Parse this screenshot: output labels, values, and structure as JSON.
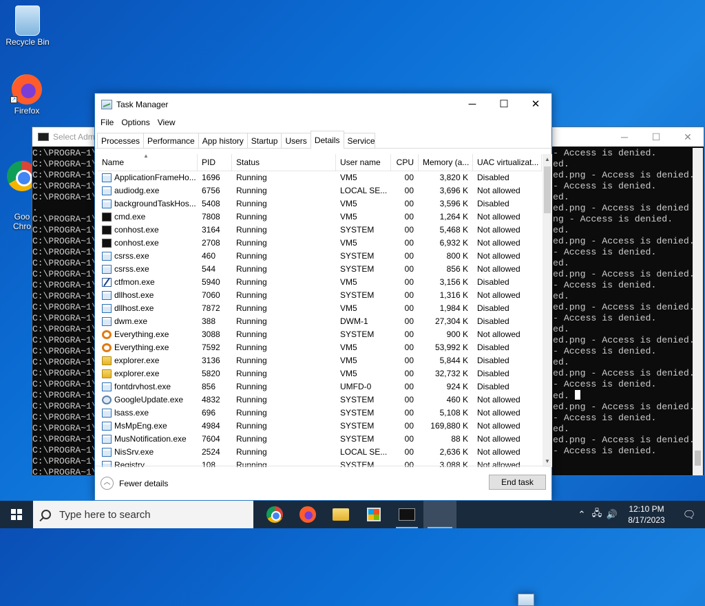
{
  "desktop": {
    "icons": [
      {
        "label": "Recycle Bin"
      },
      {
        "label": "Firefox"
      },
      {
        "label": "Goo\nChro"
      }
    ]
  },
  "console": {
    "title": "Select Admi",
    "left_lines": [
      "C:\\PROGRA~1\\",
      "C:\\PROGRA~1\\",
      "C:\\PROGRA~1\\",
      "C:\\PROGRA~1\\",
      "C:\\PROGRA~1\\",
      ".",
      "C:\\PROGRA~1\\",
      "C:\\PROGRA~1\\",
      "C:\\PROGRA~1\\",
      "C:\\PROGRA~1\\",
      "C:\\PROGRA~1\\",
      "C:\\PROGRA~1\\",
      "C:\\PROGRA~1\\",
      "C:\\PROGRA~1\\",
      "C:\\PROGRA~1\\",
      "C:\\PROGRA~1\\",
      "C:\\PROGRA~1\\",
      "C:\\PROGRA~1\\",
      "C:\\PROGRA~1\\",
      "C:\\PROGRA~1\\",
      "C:\\PROGRA~1\\",
      "C:\\PROGRA~1\\",
      "C:\\PROGRA~1\\",
      "C:\\PROGRA~1\\",
      "C:\\PROGRA~1\\",
      "C:\\PROGRA~1\\",
      "C:\\PROGRA~1\\",
      "C:\\PROGRA~1\\",
      "C:\\PROGRA~1\\",
      "C:\\PROGRA~1\\"
    ],
    "right_lines": [
      "- Access is denied.",
      "ed.",
      "ed.png - Access is denied.",
      "- Access is denied.",
      "ed.",
      "ed.png - Access is denied",
      "",
      "ng - Access is denied.",
      "ed.",
      "ed.png - Access is denied.",
      "- Access is denied.",
      "ed.",
      "ed.png - Access is denied.",
      "- Access is denied.",
      "ed.",
      "ed.png - Access is denied.",
      "- Access is denied.",
      "ed.",
      "ed.png - Access is denied.",
      "- Access is denied.",
      "ed.",
      "ed.png - Access is denied.",
      "- Access is denied.",
      "ed. ",
      "ed.png - Access is denied.",
      "- Access is denied.",
      "ed.",
      "ed.png - Access is denied.",
      "- Access is denied.",
      ""
    ]
  },
  "task_manager": {
    "title": "Task Manager",
    "menu": [
      "File",
      "Options",
      "View"
    ],
    "tabs": [
      "Processes",
      "Performance",
      "App history",
      "Startup",
      "Users",
      "Details",
      "Services"
    ],
    "active_tab": "Details",
    "columns": [
      "Name",
      "PID",
      "Status",
      "User name",
      "CPU",
      "Memory (a...",
      "UAC virtualizat..."
    ],
    "rows": [
      {
        "icon": "app",
        "name": "ApplicationFrameHo...",
        "pid": "1696",
        "status": "Running",
        "user": "VM5",
        "cpu": "00",
        "mem": "3,820 K",
        "uac": "Disabled"
      },
      {
        "icon": "app",
        "name": "audiodg.exe",
        "pid": "6756",
        "status": "Running",
        "user": "LOCAL SE...",
        "cpu": "00",
        "mem": "3,696 K",
        "uac": "Not allowed"
      },
      {
        "icon": "app",
        "name": "backgroundTaskHos...",
        "pid": "5408",
        "status": "Running",
        "user": "VM5",
        "cpu": "00",
        "mem": "3,596 K",
        "uac": "Disabled"
      },
      {
        "icon": "cmd",
        "name": "cmd.exe",
        "pid": "7808",
        "status": "Running",
        "user": "VM5",
        "cpu": "00",
        "mem": "1,264 K",
        "uac": "Not allowed"
      },
      {
        "icon": "cmd",
        "name": "conhost.exe",
        "pid": "3164",
        "status": "Running",
        "user": "SYSTEM",
        "cpu": "00",
        "mem": "5,468 K",
        "uac": "Not allowed"
      },
      {
        "icon": "cmd",
        "name": "conhost.exe",
        "pid": "2708",
        "status": "Running",
        "user": "VM5",
        "cpu": "00",
        "mem": "6,932 K",
        "uac": "Not allowed"
      },
      {
        "icon": "app",
        "name": "csrss.exe",
        "pid": "460",
        "status": "Running",
        "user": "SYSTEM",
        "cpu": "00",
        "mem": "800 K",
        "uac": "Not allowed"
      },
      {
        "icon": "app",
        "name": "csrss.exe",
        "pid": "544",
        "status": "Running",
        "user": "SYSTEM",
        "cpu": "00",
        "mem": "856 K",
        "uac": "Not allowed"
      },
      {
        "icon": "ctf",
        "name": "ctfmon.exe",
        "pid": "5940",
        "status": "Running",
        "user": "VM5",
        "cpu": "00",
        "mem": "3,156 K",
        "uac": "Disabled"
      },
      {
        "icon": "app",
        "name": "dllhost.exe",
        "pid": "7060",
        "status": "Running",
        "user": "SYSTEM",
        "cpu": "00",
        "mem": "1,316 K",
        "uac": "Not allowed"
      },
      {
        "icon": "app",
        "name": "dllhost.exe",
        "pid": "7872",
        "status": "Running",
        "user": "VM5",
        "cpu": "00",
        "mem": "1,984 K",
        "uac": "Disabled"
      },
      {
        "icon": "app",
        "name": "dwm.exe",
        "pid": "388",
        "status": "Running",
        "user": "DWM-1",
        "cpu": "00",
        "mem": "27,304 K",
        "uac": "Disabled"
      },
      {
        "icon": "search",
        "name": "Everything.exe",
        "pid": "3088",
        "status": "Running",
        "user": "SYSTEM",
        "cpu": "00",
        "mem": "900 K",
        "uac": "Not allowed"
      },
      {
        "icon": "search",
        "name": "Everything.exe",
        "pid": "7592",
        "status": "Running",
        "user": "VM5",
        "cpu": "00",
        "mem": "53,992 K",
        "uac": "Disabled"
      },
      {
        "icon": "folder",
        "name": "explorer.exe",
        "pid": "3136",
        "status": "Running",
        "user": "VM5",
        "cpu": "00",
        "mem": "5,844 K",
        "uac": "Disabled"
      },
      {
        "icon": "folder",
        "name": "explorer.exe",
        "pid": "5820",
        "status": "Running",
        "user": "VM5",
        "cpu": "00",
        "mem": "32,732 K",
        "uac": "Disabled"
      },
      {
        "icon": "app",
        "name": "fontdrvhost.exe",
        "pid": "856",
        "status": "Running",
        "user": "UMFD-0",
        "cpu": "00",
        "mem": "924 K",
        "uac": "Disabled"
      },
      {
        "icon": "gear",
        "name": "GoogleUpdate.exe",
        "pid": "4832",
        "status": "Running",
        "user": "SYSTEM",
        "cpu": "00",
        "mem": "460 K",
        "uac": "Not allowed"
      },
      {
        "icon": "app",
        "name": "lsass.exe",
        "pid": "696",
        "status": "Running",
        "user": "SYSTEM",
        "cpu": "00",
        "mem": "5,108 K",
        "uac": "Not allowed"
      },
      {
        "icon": "app",
        "name": "MsMpEng.exe",
        "pid": "4984",
        "status": "Running",
        "user": "SYSTEM",
        "cpu": "00",
        "mem": "169,880 K",
        "uac": "Not allowed"
      },
      {
        "icon": "app",
        "name": "MusNotification.exe",
        "pid": "7604",
        "status": "Running",
        "user": "SYSTEM",
        "cpu": "00",
        "mem": "88 K",
        "uac": "Not allowed"
      },
      {
        "icon": "app",
        "name": "NisSrv.exe",
        "pid": "2524",
        "status": "Running",
        "user": "LOCAL SE...",
        "cpu": "00",
        "mem": "2,636 K",
        "uac": "Not allowed"
      },
      {
        "icon": "app",
        "name": "Registry",
        "pid": "108",
        "status": "Running",
        "user": "SYSTEM",
        "cpu": "00",
        "mem": "3,088 K",
        "uac": "Not allowed"
      }
    ],
    "fewer_details": "Fewer details",
    "end_task": "End task"
  },
  "taskbar": {
    "search_placeholder": "Type here to search",
    "time": "12:10 PM",
    "date": "8/17/2023"
  }
}
